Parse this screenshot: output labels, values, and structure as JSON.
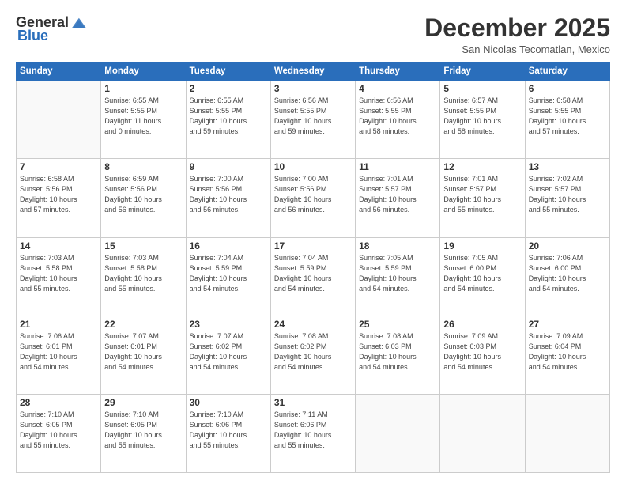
{
  "logo": {
    "general": "General",
    "blue": "Blue"
  },
  "header": {
    "month": "December 2025",
    "location": "San Nicolas Tecomatlan, Mexico"
  },
  "days_of_week": [
    "Sunday",
    "Monday",
    "Tuesday",
    "Wednesday",
    "Thursday",
    "Friday",
    "Saturday"
  ],
  "weeks": [
    [
      {
        "day": "",
        "info": ""
      },
      {
        "day": "1",
        "info": "Sunrise: 6:55 AM\nSunset: 5:55 PM\nDaylight: 11 hours\nand 0 minutes."
      },
      {
        "day": "2",
        "info": "Sunrise: 6:55 AM\nSunset: 5:55 PM\nDaylight: 10 hours\nand 59 minutes."
      },
      {
        "day": "3",
        "info": "Sunrise: 6:56 AM\nSunset: 5:55 PM\nDaylight: 10 hours\nand 59 minutes."
      },
      {
        "day": "4",
        "info": "Sunrise: 6:56 AM\nSunset: 5:55 PM\nDaylight: 10 hours\nand 58 minutes."
      },
      {
        "day": "5",
        "info": "Sunrise: 6:57 AM\nSunset: 5:55 PM\nDaylight: 10 hours\nand 58 minutes."
      },
      {
        "day": "6",
        "info": "Sunrise: 6:58 AM\nSunset: 5:55 PM\nDaylight: 10 hours\nand 57 minutes."
      }
    ],
    [
      {
        "day": "7",
        "info": "Sunrise: 6:58 AM\nSunset: 5:56 PM\nDaylight: 10 hours\nand 57 minutes."
      },
      {
        "day": "8",
        "info": "Sunrise: 6:59 AM\nSunset: 5:56 PM\nDaylight: 10 hours\nand 56 minutes."
      },
      {
        "day": "9",
        "info": "Sunrise: 7:00 AM\nSunset: 5:56 PM\nDaylight: 10 hours\nand 56 minutes."
      },
      {
        "day": "10",
        "info": "Sunrise: 7:00 AM\nSunset: 5:56 PM\nDaylight: 10 hours\nand 56 minutes."
      },
      {
        "day": "11",
        "info": "Sunrise: 7:01 AM\nSunset: 5:57 PM\nDaylight: 10 hours\nand 56 minutes."
      },
      {
        "day": "12",
        "info": "Sunrise: 7:01 AM\nSunset: 5:57 PM\nDaylight: 10 hours\nand 55 minutes."
      },
      {
        "day": "13",
        "info": "Sunrise: 7:02 AM\nSunset: 5:57 PM\nDaylight: 10 hours\nand 55 minutes."
      }
    ],
    [
      {
        "day": "14",
        "info": "Sunrise: 7:03 AM\nSunset: 5:58 PM\nDaylight: 10 hours\nand 55 minutes."
      },
      {
        "day": "15",
        "info": "Sunrise: 7:03 AM\nSunset: 5:58 PM\nDaylight: 10 hours\nand 55 minutes."
      },
      {
        "day": "16",
        "info": "Sunrise: 7:04 AM\nSunset: 5:59 PM\nDaylight: 10 hours\nand 54 minutes."
      },
      {
        "day": "17",
        "info": "Sunrise: 7:04 AM\nSunset: 5:59 PM\nDaylight: 10 hours\nand 54 minutes."
      },
      {
        "day": "18",
        "info": "Sunrise: 7:05 AM\nSunset: 5:59 PM\nDaylight: 10 hours\nand 54 minutes."
      },
      {
        "day": "19",
        "info": "Sunrise: 7:05 AM\nSunset: 6:00 PM\nDaylight: 10 hours\nand 54 minutes."
      },
      {
        "day": "20",
        "info": "Sunrise: 7:06 AM\nSunset: 6:00 PM\nDaylight: 10 hours\nand 54 minutes."
      }
    ],
    [
      {
        "day": "21",
        "info": "Sunrise: 7:06 AM\nSunset: 6:01 PM\nDaylight: 10 hours\nand 54 minutes."
      },
      {
        "day": "22",
        "info": "Sunrise: 7:07 AM\nSunset: 6:01 PM\nDaylight: 10 hours\nand 54 minutes."
      },
      {
        "day": "23",
        "info": "Sunrise: 7:07 AM\nSunset: 6:02 PM\nDaylight: 10 hours\nand 54 minutes."
      },
      {
        "day": "24",
        "info": "Sunrise: 7:08 AM\nSunset: 6:02 PM\nDaylight: 10 hours\nand 54 minutes."
      },
      {
        "day": "25",
        "info": "Sunrise: 7:08 AM\nSunset: 6:03 PM\nDaylight: 10 hours\nand 54 minutes."
      },
      {
        "day": "26",
        "info": "Sunrise: 7:09 AM\nSunset: 6:03 PM\nDaylight: 10 hours\nand 54 minutes."
      },
      {
        "day": "27",
        "info": "Sunrise: 7:09 AM\nSunset: 6:04 PM\nDaylight: 10 hours\nand 54 minutes."
      }
    ],
    [
      {
        "day": "28",
        "info": "Sunrise: 7:10 AM\nSunset: 6:05 PM\nDaylight: 10 hours\nand 55 minutes."
      },
      {
        "day": "29",
        "info": "Sunrise: 7:10 AM\nSunset: 6:05 PM\nDaylight: 10 hours\nand 55 minutes."
      },
      {
        "day": "30",
        "info": "Sunrise: 7:10 AM\nSunset: 6:06 PM\nDaylight: 10 hours\nand 55 minutes."
      },
      {
        "day": "31",
        "info": "Sunrise: 7:11 AM\nSunset: 6:06 PM\nDaylight: 10 hours\nand 55 minutes."
      },
      {
        "day": "",
        "info": ""
      },
      {
        "day": "",
        "info": ""
      },
      {
        "day": "",
        "info": ""
      }
    ]
  ]
}
